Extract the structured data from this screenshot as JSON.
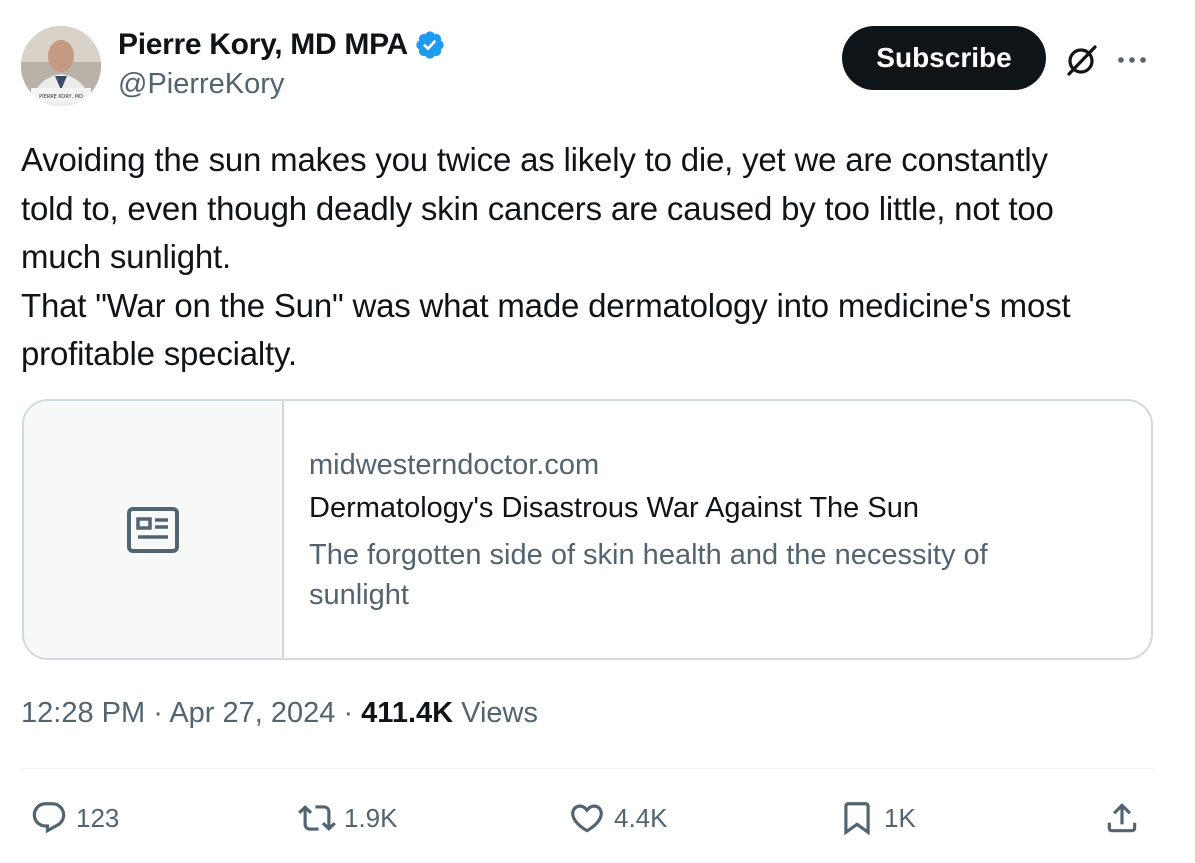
{
  "author": {
    "name": "Pierre Kory, MD MPA",
    "handle": "@PierreKory",
    "avatar_caption": "PIERRE KORY, MD"
  },
  "header": {
    "subscribe_label": "Subscribe",
    "grok_icon": "grok-icon",
    "more_icon": "more-icon"
  },
  "tweet": {
    "lines": [
      "Avoiding the sun makes you twice as likely to die, yet we are constantly",
      "told to, even though deadly skin cancers are caused by too little, not too",
      "much sunlight.",
      "That \"War on the Sun\" was what made dermatology into medicine's most",
      "profitable specialty."
    ]
  },
  "card": {
    "domain": "midwesterndoctor.com",
    "title": "Dermatology's Disastrous War Against The Sun",
    "description": "The forgotten side of skin health and the necessity of sunlight",
    "thumb_icon": "article-icon"
  },
  "meta": {
    "time": "12:28 PM",
    "separator": " · ",
    "date": "Apr 27, 2024",
    "views_count": "411.4K",
    "views_label": " Views"
  },
  "actions": {
    "replies": "123",
    "reposts": "1.9K",
    "likes": "4.4K",
    "bookmarks": "1K"
  },
  "colors": {
    "text": "#0f1419",
    "secondary": "#536471",
    "verified": "#1d9bf0",
    "border": "#cfd9de"
  }
}
